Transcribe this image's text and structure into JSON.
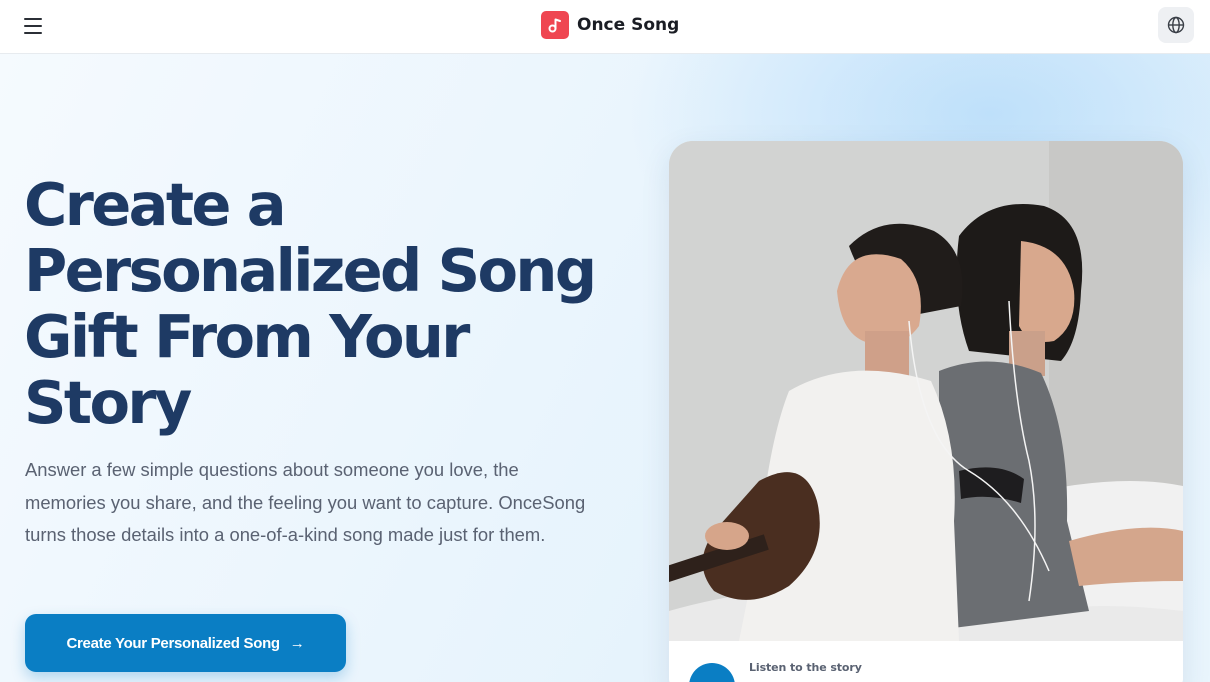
{
  "app": {
    "brand_name": "Once Song",
    "brand_color": "#ef4651",
    "accent_color": "#0a7ec4",
    "headline_color": "#1e3a64"
  },
  "header": {
    "menu_icon": "hamburger-menu-icon",
    "logo_icon": "music-note-icon",
    "language_icon": "globe-icon"
  },
  "hero": {
    "headline": "Create a Personalized Song Gift From Your Story",
    "description": "Answer a few simple questions about someone you love, the memories you share, and the feeling you want to capture. OnceSong turns those details into a one-of-a-kind song made just for them.",
    "cta_label": "Create Your Personalized Song",
    "cta_arrow": "→"
  },
  "story_card": {
    "image_icon": "couple-with-guitar-photo",
    "listen_label": "Listen to the story",
    "play_icon": "play-icon"
  }
}
